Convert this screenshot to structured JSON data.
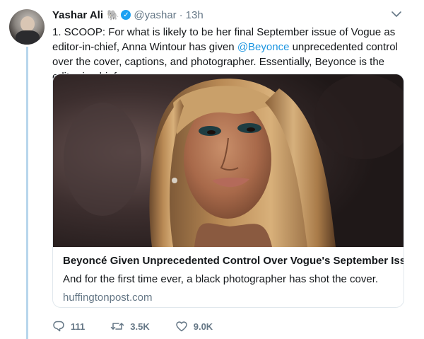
{
  "tweet": {
    "author_name": "Yashar Ali",
    "author_emoji": "🐘",
    "handle": "@yashar",
    "separator": "·",
    "time": "13h",
    "text_part1": "1. SCOOP: For what is likely to be her final September issue of Vogue as editor-in-chief, Anna Wintour has given ",
    "mention": "@Beyonce",
    "text_part2": " unprecedented control over the cover, captions, and photographer. Essentially, Beyonce is the editor-in-chief"
  },
  "card": {
    "title": "Beyoncé Given Unprecedented Control Over Vogue's September Iss...",
    "description": "And for the first time ever, a black photographer has shot the cover.",
    "domain": "huffingtonpost.com"
  },
  "actions": {
    "replies": "111",
    "retweets": "3.5K",
    "likes": "9.0K"
  },
  "colors": {
    "link": "#1b95e0",
    "verified": "#1da1f2",
    "muted": "#657786",
    "thread_line": "#b8d6ec"
  },
  "icons": [
    "verified-badge-icon",
    "chevron-down-icon",
    "reply-icon",
    "retweet-icon",
    "like-icon"
  ]
}
